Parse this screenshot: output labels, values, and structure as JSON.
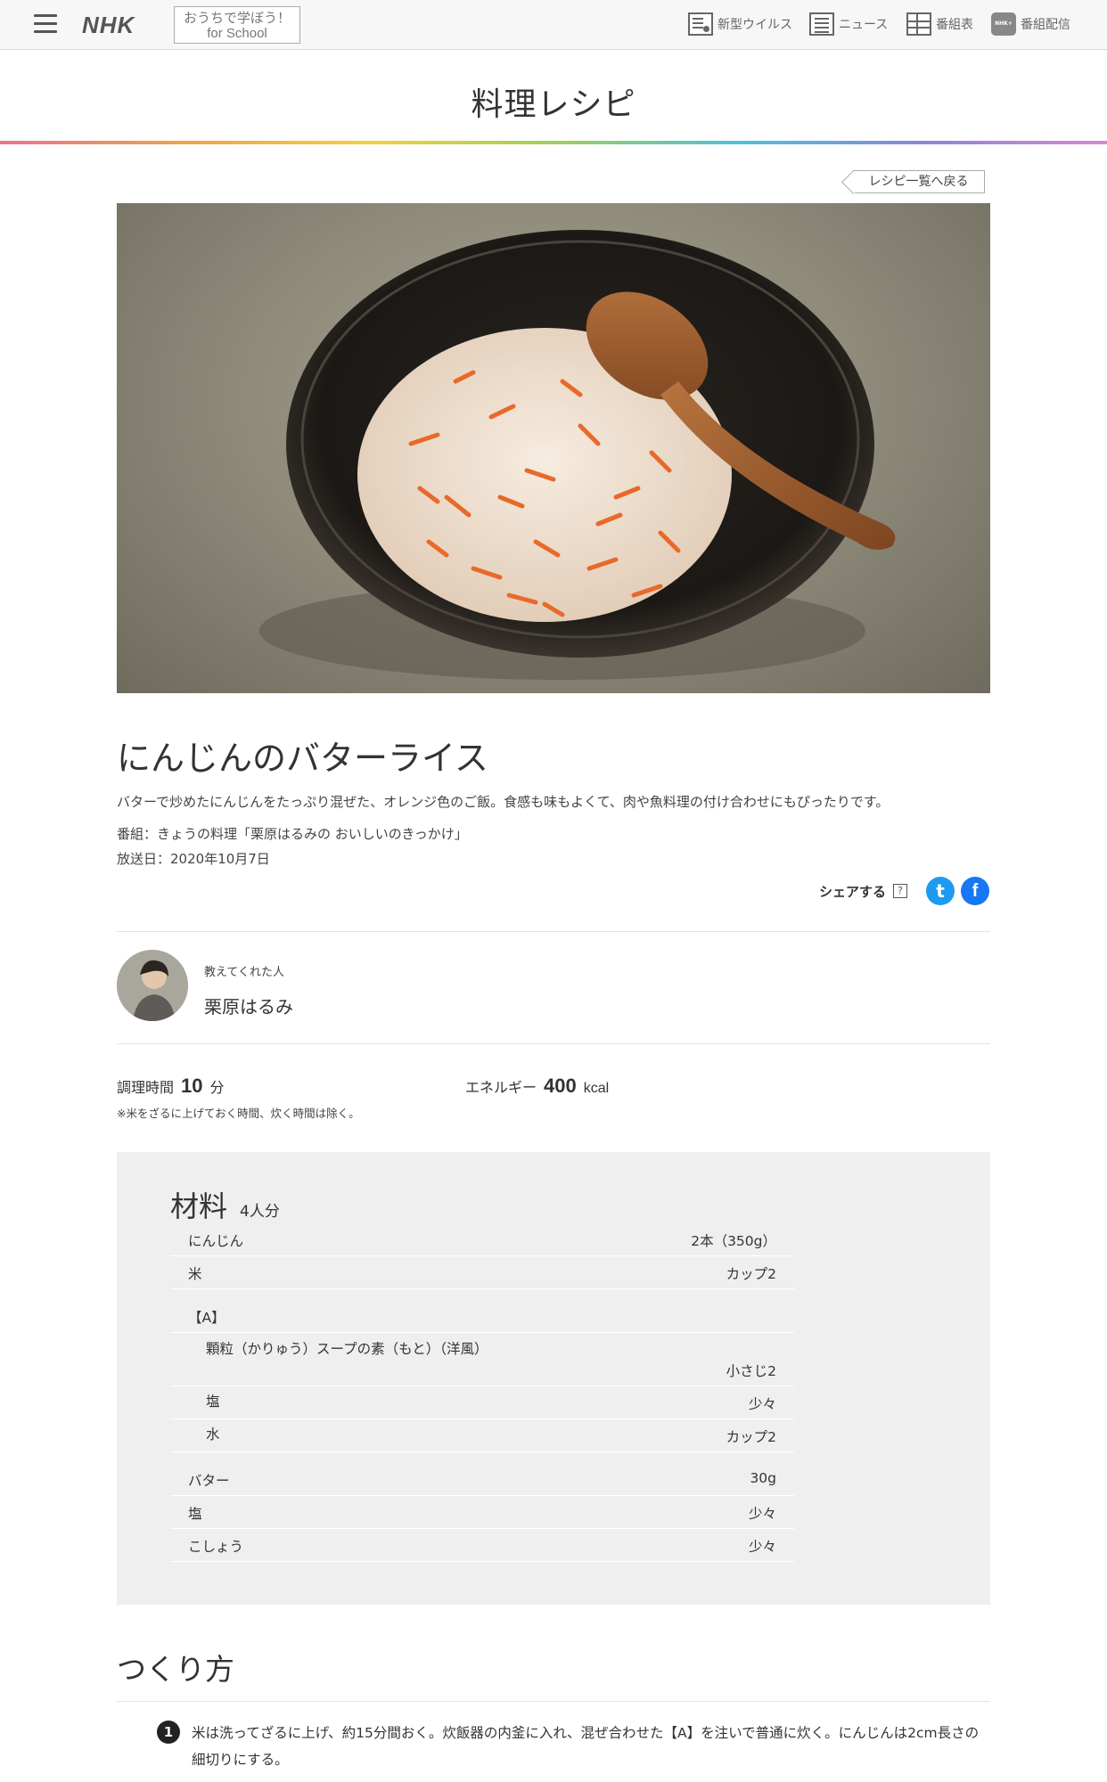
{
  "header": {
    "logo": "NHK",
    "school_line1": "おうちで学ぼう！",
    "school_line2": "for School",
    "nav": [
      {
        "label": "新型ウイルス",
        "icon": "virus-news-icon"
      },
      {
        "label": "ニュース",
        "icon": "news-icon"
      },
      {
        "label": "番組表",
        "icon": "program-guide-icon"
      },
      {
        "label": "番組配信",
        "icon": "streaming-icon",
        "badge": "NHK+"
      }
    ]
  },
  "page": {
    "section_title": "料理レシピ",
    "back_label": "レシピ一覧へ戻る"
  },
  "recipe": {
    "title": "にんじんのバターライス",
    "description": "バターで炒めたにんじんをたっぷり混ぜた、オレンジ色のご飯。食感も味もよくて、肉や魚料理の付け合わせにもぴったりです。",
    "program": "番組：きょうの料理「栗原はるみの おいしいのきっかけ」",
    "broadcast": "放送日：2020年10月7日",
    "share_label": "シェアする",
    "share_help": "?",
    "twitter_glyph": "t",
    "facebook_glyph": "f",
    "teacher_label": "教えてくれた人",
    "teacher_name": "栗原はるみ",
    "cook_time_label": "調理時間",
    "cook_time_value": "10",
    "cook_time_unit": "分",
    "energy_label": "エネルギー",
    "energy_value": "400",
    "energy_unit": "kcal",
    "time_note": "※米をざるに上げておく時間、炊く時間は除く。"
  },
  "ingredients": {
    "heading": "材料",
    "servings": "4人分",
    "rows": [
      {
        "name": "にんじん",
        "amount": "2本（350g）"
      },
      {
        "name": "米",
        "amount": "カップ2"
      },
      {
        "name": "【A】",
        "amount": ""
      },
      {
        "name": "顆粒（かりゅう）スープの素（もと）（洋風）",
        "amount": "小さじ2"
      },
      {
        "name": "塩",
        "amount": "少々"
      },
      {
        "name": "水",
        "amount": "カップ2"
      },
      {
        "name": "バター",
        "amount": "30g"
      },
      {
        "name": "塩",
        "amount": "少々"
      },
      {
        "name": "こしょう",
        "amount": "少々"
      }
    ]
  },
  "howto": {
    "heading": "つくり方",
    "steps": [
      {
        "num": "1",
        "text": "米は洗ってざるに上げ、約15分間おく。炊飯器の内釜に入れ、混ぜ合わせた【A】を注いで普通に炊く。にんじんは2cm長さの細切りにする。"
      }
    ]
  }
}
